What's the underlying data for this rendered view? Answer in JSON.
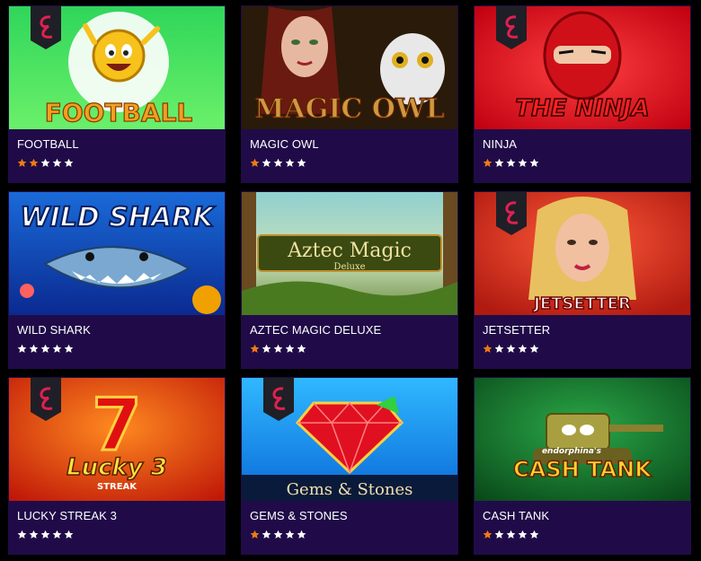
{
  "games": [
    {
      "title": "FOOTBALL",
      "rating": 2,
      "art_text": "FOOTBALL"
    },
    {
      "title": "MAGIC OWL",
      "rating": 1,
      "art_text": "MAGIC OWL"
    },
    {
      "title": "NINJA",
      "rating": 1,
      "art_text": "THE NINJA"
    },
    {
      "title": "WILD SHARK",
      "rating": 0,
      "art_text": "WILD SHARK"
    },
    {
      "title": "AZTEC MAGIC DELUXE",
      "rating": 1,
      "art_text": "Aztec Magic",
      "art_subtext": "Deluxe"
    },
    {
      "title": "JETSETTER",
      "rating": 1,
      "art_text": "JETSETTER"
    },
    {
      "title": "LUCKY STREAK 3",
      "rating": 0,
      "art_text": "Lucky 3",
      "art_subtext": "STREAK"
    },
    {
      "title": "GEMS & STONES",
      "rating": 1,
      "art_text": "Gems & Stones"
    },
    {
      "title": "CASH TANK",
      "rating": 1,
      "art_text": "CASH TANK",
      "art_subtext": "endorphina's"
    }
  ],
  "colors": {
    "card_bg": "#200b48",
    "star_filled": "#f07a12",
    "star_empty": "#ffffff",
    "provider_badge": "#1f1f27",
    "provider_accent": "#e02050"
  },
  "max_rating": 5,
  "provider_logo_icon": "endorphina-logo-icon"
}
